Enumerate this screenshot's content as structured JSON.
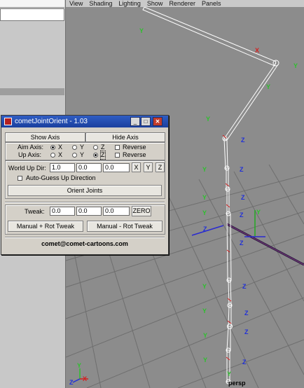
{
  "menu": [
    "View",
    "Shading",
    "Lighting",
    "Show",
    "Renderer",
    "Panels"
  ],
  "scene": {
    "axis_x": "X",
    "axis_y": "Y",
    "axis_z": "Z",
    "camera_label": "persp",
    "colors": {
      "x_axis": "#d42020",
      "y_axis": "#2ec02e",
      "z_axis": "#2030d8",
      "grid": "#6e6e6e",
      "bone": "#ffffff"
    }
  },
  "dialog": {
    "title": "cometJointOrient - 1.03",
    "window_buttons": {
      "minimize": "_",
      "maximize": "□",
      "close": "✕"
    },
    "show_axis": "Show Axis",
    "hide_axis": "Hide Axis",
    "aim_axis_label": "Aim Axis:",
    "up_axis_label": "Up Axis:",
    "axis_options": [
      "X",
      "Y",
      "Z"
    ],
    "aim_axis_selected": "X",
    "up_axis_selected": "Z",
    "reverse_label": "Reverse",
    "world_up_label": "World Up Dir:",
    "world_up_values": [
      "1.0",
      "0.0",
      "0.0"
    ],
    "world_up_buttons": [
      "X",
      "Y",
      "Z"
    ],
    "auto_guess_label": "Auto-Guess Up Direction",
    "orient_joints": "Orient Joints",
    "tweak_label": "Tweak:",
    "tweak_values": [
      "0.0",
      "0.0",
      "0.0"
    ],
    "zero_button": "ZERO",
    "manual_plus": "Manual + Rot Tweak",
    "manual_minus": "Manual - Rot Tweak",
    "footer": "comet@comet-cartoons.com"
  }
}
